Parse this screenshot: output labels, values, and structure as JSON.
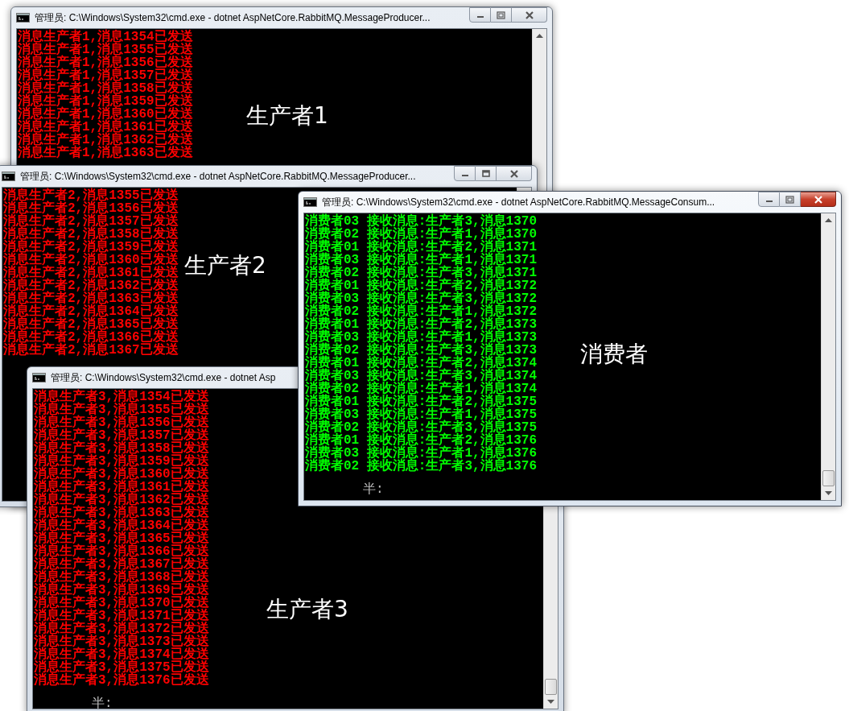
{
  "windows": [
    {
      "title": "管理员: C:\\Windows\\System32\\cmd.exe - dotnet  AspNetCore.RabbitMQ.MessageProducer...",
      "active": false,
      "kind": "producer",
      "window_buttons": [
        {
          "kind": "minimize"
        },
        {
          "kind": "restore"
        },
        {
          "kind": "close"
        }
      ],
      "lines": [
        "消息生产者1,消息1354已发送",
        "消息生产者1,消息1355已发送",
        "消息生产者1,消息1356已发送",
        "消息生产者1,消息1357已发送",
        "消息生产者1,消息1358已发送",
        "消息生产者1,消息1359已发送",
        "消息生产者1,消息1360已发送",
        "消息生产者1,消息1361已发送",
        "消息生产者1,消息1362已发送",
        "消息生产者1,消息1363已发送"
      ],
      "label": "生产者1"
    },
    {
      "title": "管理员: C:\\Windows\\System32\\cmd.exe - dotnet  AspNetCore.RabbitMQ.MessageProducer...",
      "active": false,
      "kind": "producer",
      "window_buttons": [
        {
          "kind": "minimize"
        },
        {
          "kind": "maximize"
        },
        {
          "kind": "close"
        }
      ],
      "lines": [
        "消息生产者2,消息1355已发送",
        "消息生产者2,消息1356已发送",
        "消息生产者2,消息1357已发送",
        "消息生产者2,消息1358已发送",
        "消息生产者2,消息1359已发送",
        "消息生产者2,消息1360已发送",
        "消息生产者2,消息1361已发送",
        "消息生产者2,消息1362已发送",
        "消息生产者2,消息1363已发送",
        "消息生产者2,消息1364已发送",
        "消息生产者2,消息1365已发送",
        "消息生产者2,消息1366已发送",
        "消息生产者2,消息1367已发送"
      ],
      "label": "生产者2"
    },
    {
      "title": "管理员: C:\\Windows\\System32\\cmd.exe - dotnet  Asp",
      "active": false,
      "kind": "producer",
      "lines": [
        "消息生产者3,消息1354已发送",
        "消息生产者3,消息1355已发送",
        "消息生产者3,消息1356已发送",
        "消息生产者3,消息1357已发送",
        "消息生产者3,消息1358已发送",
        "消息生产者3,消息1359已发送",
        "消息生产者3,消息1360已发送",
        "消息生产者3,消息1361已发送",
        "消息生产者3,消息1362已发送",
        "消息生产者3,消息1363已发送",
        "消息生产者3,消息1364已发送",
        "消息生产者3,消息1365已发送",
        "消息生产者3,消息1366已发送",
        "消息生产者3,消息1367已发送",
        "消息生产者3,消息1368已发送",
        "消息生产者3,消息1369已发送",
        "消息生产者3,消息1370已发送",
        "消息生产者3,消息1371已发送",
        "消息生产者3,消息1372已发送",
        "消息生产者3,消息1373已发送",
        "消息生产者3,消息1374已发送",
        "消息生产者3,消息1375已发送",
        "消息生产者3,消息1376已发送"
      ],
      "label": "生产者3",
      "prompt": "半:"
    },
    {
      "title": "管理员: C:\\Windows\\System32\\cmd.exe - dotnet  AspNetCore.RabbitMQ.MessageConsum...",
      "active": true,
      "kind": "consumer",
      "window_buttons": [
        {
          "kind": "minimize"
        },
        {
          "kind": "restore"
        },
        {
          "kind": "close"
        }
      ],
      "lines": [
        "消费者03 接收消息:生产者3,消息1370",
        "消费者02 接收消息:生产者1,消息1370",
        "消费者01 接收消息:生产者2,消息1371",
        "消费者03 接收消息:生产者1,消息1371",
        "消费者02 接收消息:生产者3,消息1371",
        "消费者01 接收消息:生产者2,消息1372",
        "消费者03 接收消息:生产者3,消息1372",
        "消费者02 接收消息:生产者1,消息1372",
        "消费者01 接收消息:生产者2,消息1373",
        "消费者03 接收消息:生产者1,消息1373",
        "消费者02 接收消息:生产者3,消息1373",
        "消费者01 接收消息:生产者2,消息1374",
        "消费者03 接收消息:生产者3,消息1374",
        "消费者02 接收消息:生产者1,消息1374",
        "消费者01 接收消息:生产者2,消息1375",
        "消费者03 接收消息:生产者1,消息1375",
        "消费者02 接收消息:生产者3,消息1375",
        "消费者01 接收消息:生产者2,消息1376",
        "消费者03 接收消息:生产者1,消息1376",
        "消费者02 接收消息:生产者3,消息1376"
      ],
      "label": "消费者",
      "prompt": "半:"
    }
  ]
}
